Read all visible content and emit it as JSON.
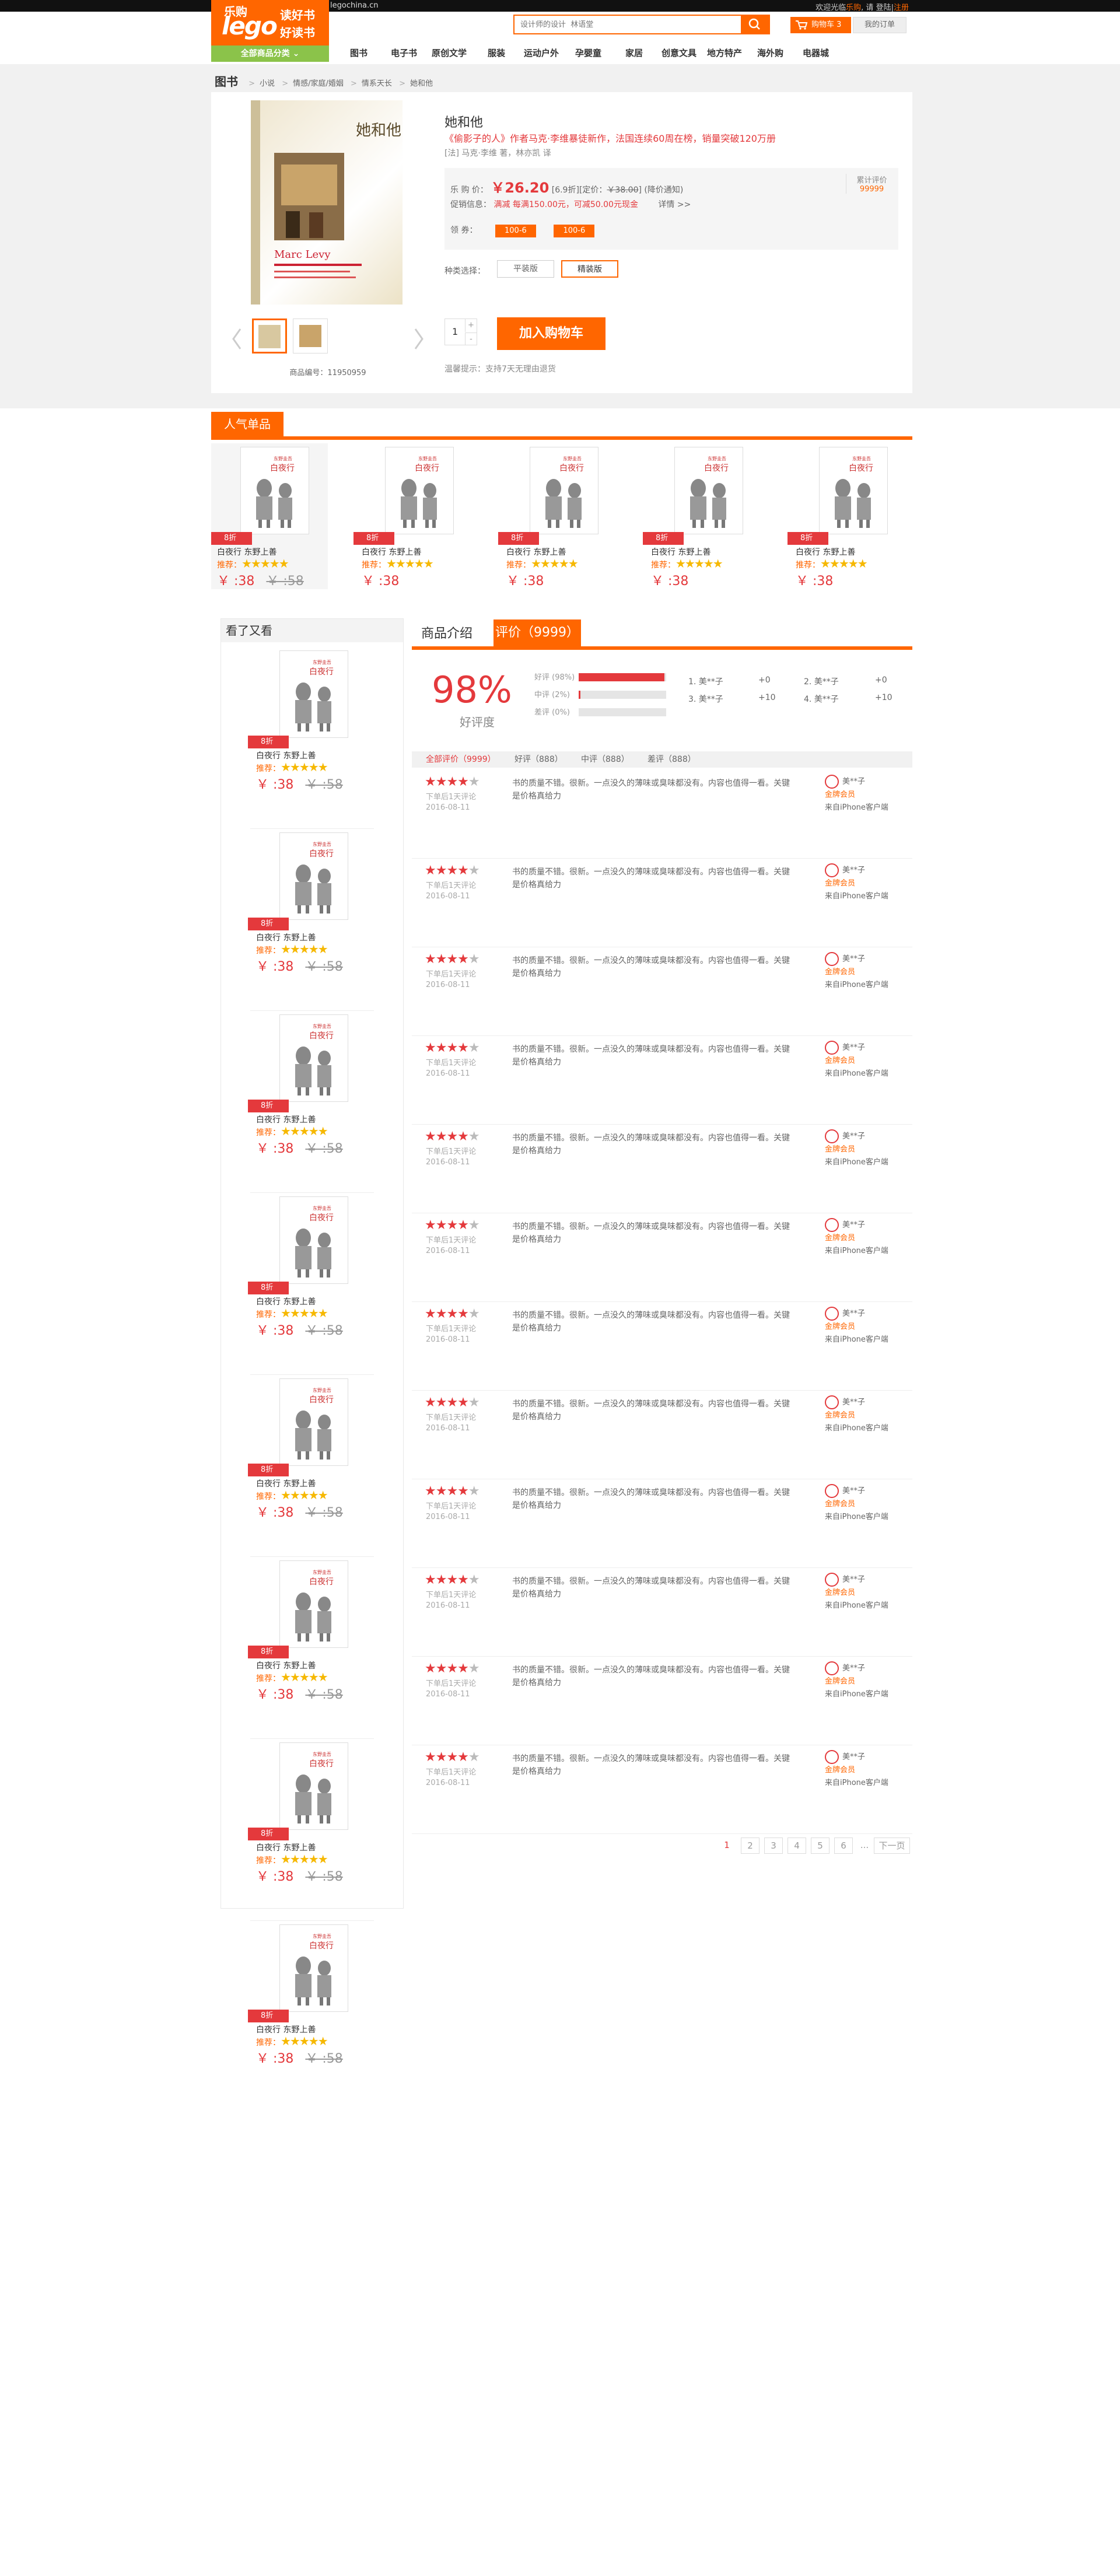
{
  "topbar": {
    "site": "legochina.cn",
    "greeting_prefix": "欢迎光临",
    "brand": "乐购",
    "greeting_mid": ", 请",
    "login": "登陆",
    "sep": "|",
    "register": "注册"
  },
  "logo": {
    "line1": "乐购",
    "line2": "lego",
    "line3": "读好书",
    "line4": "好读书"
  },
  "allcat": {
    "label": "全部商品分类"
  },
  "search": {
    "placeholder": "设计师的设计  林语堂"
  },
  "cart": {
    "label": "购物车",
    "count": "3"
  },
  "myorder": {
    "label": "我的订单"
  },
  "nav": [
    "图书",
    "电子书",
    "原创文学",
    "服装",
    "运动户外",
    "孕婴童",
    "家居",
    "创意文具",
    "地方特产",
    "海外购",
    "电器城"
  ],
  "crumb": {
    "root": "图书",
    "items": [
      "小说",
      "情感/家庭/婚姻",
      "情系天长",
      "她和他"
    ]
  },
  "product": {
    "title": "她和他",
    "subtitle": "《偷影子的人》作者马克·李维暴徒新作，法国连续60周在榜，销量突破120万册",
    "author": "[法] 马克·李维 著，林亦凯 译",
    "price_label": "乐 购 价：",
    "price": "￥26.20",
    "discount": "[6.9折]",
    "list_label": "[定价：",
    "list_price": "￥38.00",
    "list_close": "]",
    "notify": "(降价通知)",
    "promo_label": "促销信息：",
    "promo": "满减 每满150.00元，可减50.00元现金",
    "promo_more": "详情 >>",
    "review_label": "累计评价",
    "review_count": "99999",
    "coupon_label": "领 券：",
    "coupons": [
      "100-6",
      "100-6"
    ],
    "version_label": "种类选择：",
    "versions": [
      "平装版",
      "精装版"
    ],
    "qty": "1",
    "plus": "+",
    "minus": "-",
    "add_cart": "加入购物车",
    "tip": "温馨提示：支持7天无理由退货",
    "sku": "商品编号：11950959"
  },
  "hot": {
    "title": "人气单品",
    "item": {
      "badge": "8折",
      "name": "白夜行    东野上善",
      "rec": "推荐：",
      "stars": "★★★★★",
      "price": "￥ :38",
      "old": "￥ :58"
    }
  },
  "sidebar": {
    "title": "看了又看"
  },
  "tabs": {
    "intro": "商品介绍",
    "review": "评价（9999）"
  },
  "summary": {
    "pct": "98%",
    "pct_label": "好评度",
    "rows": [
      {
        "label": "好评 (98%)",
        "fill": 0.98
      },
      {
        "label": "中评 (2%)",
        "fill": 0.02
      },
      {
        "label": "差评 (0%)",
        "fill": 0
      }
    ],
    "keywords": [
      "1. 美**子",
      "+0",
      "2. 美**子",
      "+0",
      "3. 美**子",
      "+10",
      "4. 美**子",
      "+10"
    ]
  },
  "filter": {
    "all": "全部评价（9999）",
    "good": "好评（888）",
    "mid": "中评（888）",
    "bad": "差评（888）"
  },
  "review": {
    "stars": "★★★★",
    "star_off": "★",
    "meta1": "下单后1天评论",
    "date": "2016-08-11",
    "text": "书的质量不错。很新。一点没久的薄味或臭味都没有。内容也值得一看。关键是价格真给力",
    "user": "美**子",
    "level": "金牌会员",
    "client": "来自iPhone客户端"
  },
  "pager": {
    "pages": [
      "1",
      "2",
      "3",
      "4",
      "5",
      "6"
    ],
    "dots": "...",
    "next": "下一页"
  }
}
